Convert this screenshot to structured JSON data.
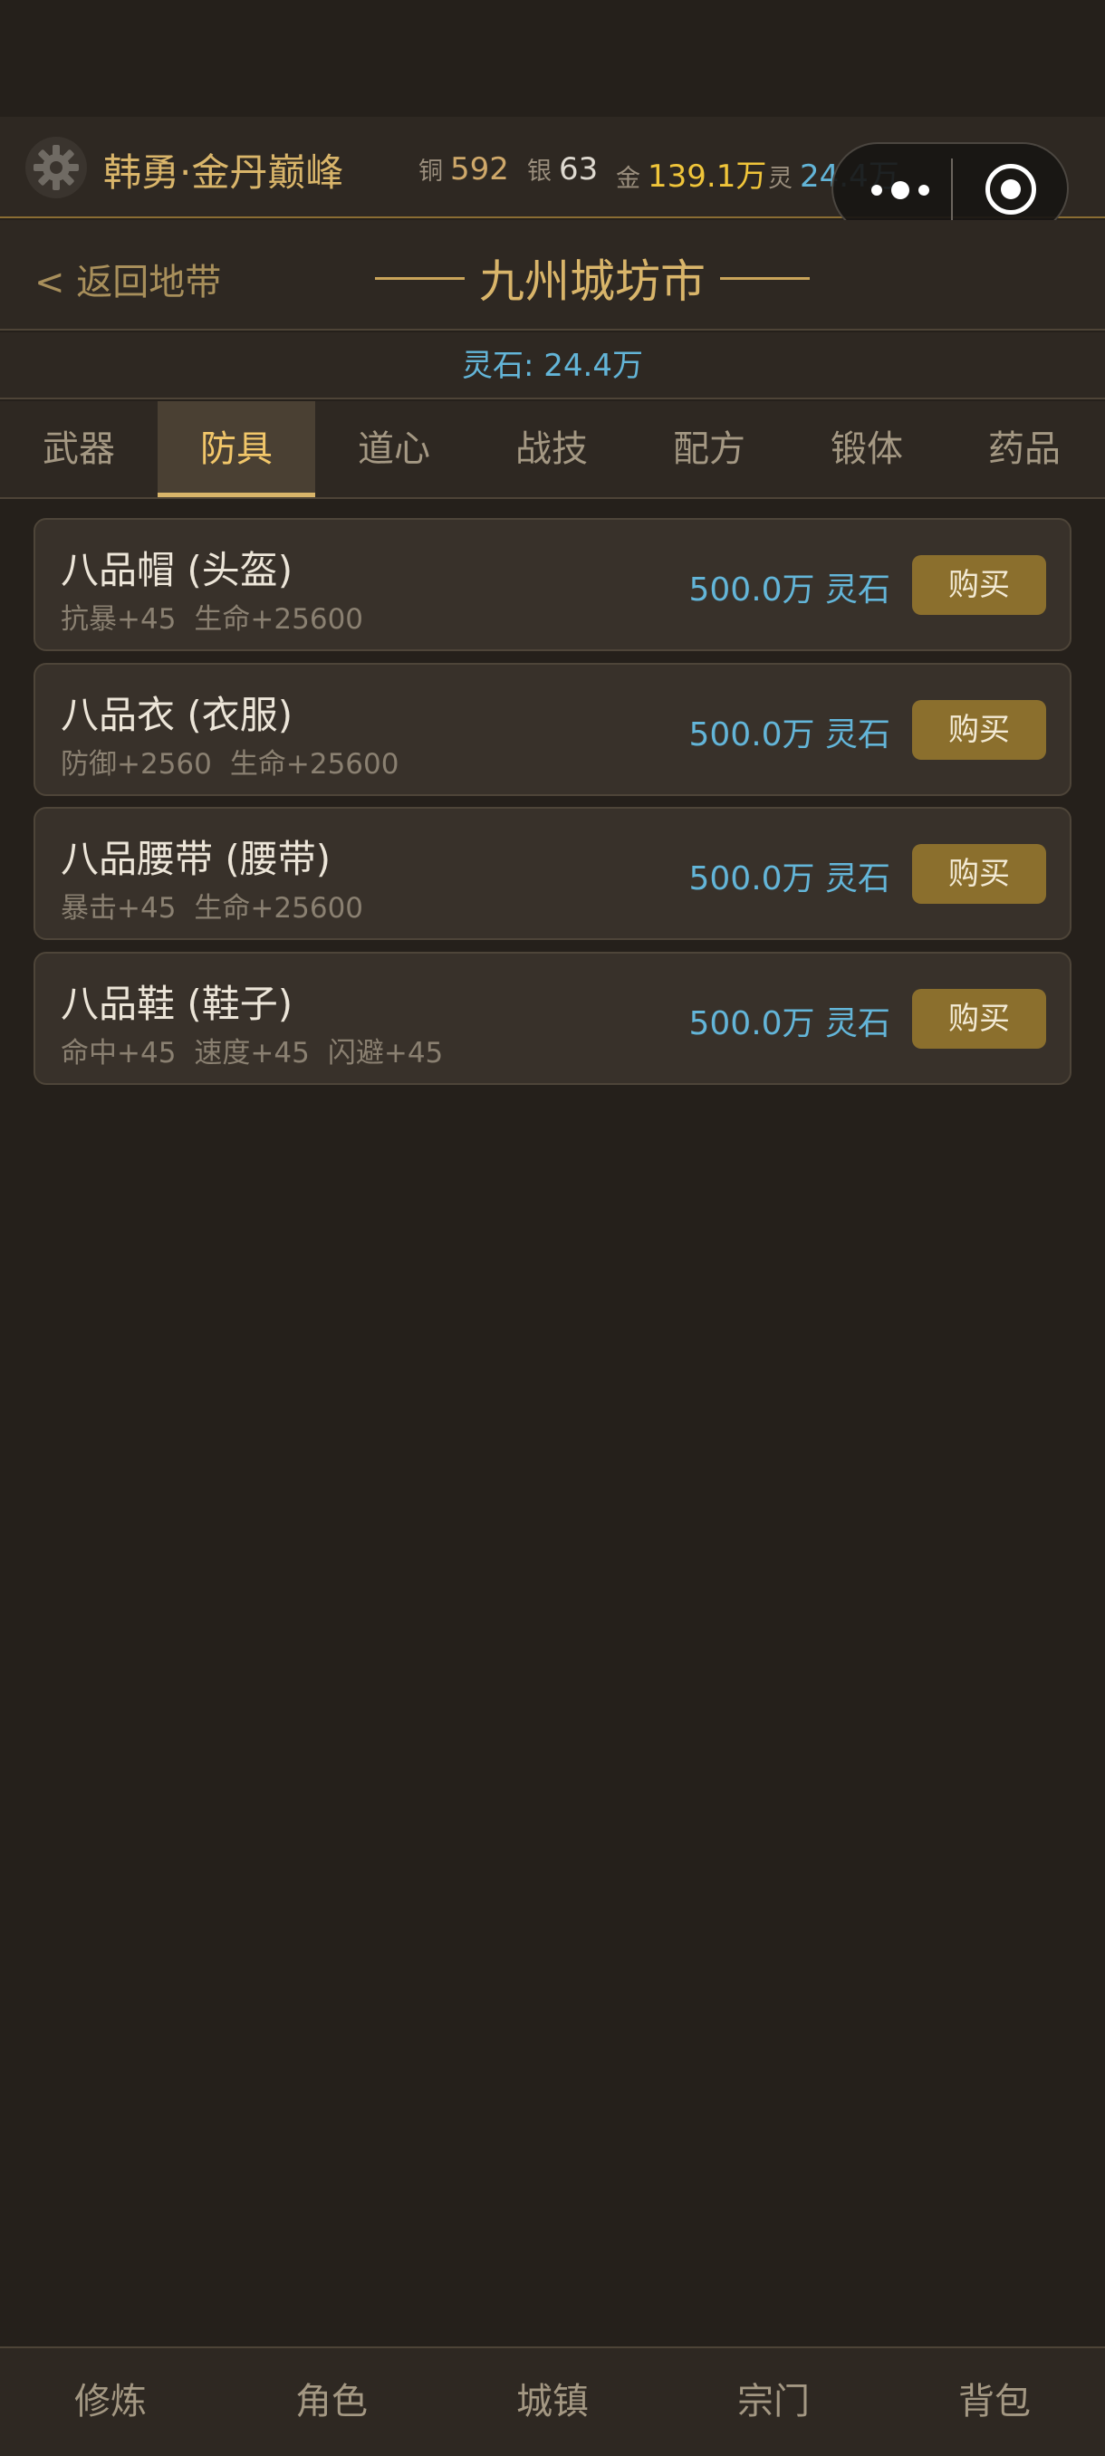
{
  "header": {
    "player_name": "韩勇·金丹巅峰",
    "currencies": [
      {
        "label": "铜",
        "value": "592"
      },
      {
        "label": "银",
        "value": "63"
      },
      {
        "label": "金",
        "value": "139.1万"
      },
      {
        "label": "灵",
        "value": "24.4万"
      }
    ],
    "icons": {
      "settings": "gear-icon",
      "more": "more-dots-icon",
      "close": "target-circle-icon"
    }
  },
  "titlebar": {
    "back_label": "< 返回地带",
    "title": "九州城坊市"
  },
  "balance": {
    "text": "灵石: 24.4万"
  },
  "tabs": [
    {
      "label": "武器",
      "active": false
    },
    {
      "label": "防具",
      "active": true
    },
    {
      "label": "道心",
      "active": false
    },
    {
      "label": "战技",
      "active": false
    },
    {
      "label": "配方",
      "active": false
    },
    {
      "label": "锻体",
      "active": false
    },
    {
      "label": "药品",
      "active": false
    }
  ],
  "items": [
    {
      "name": "八品帽 (头盔)",
      "stats": [
        "抗暴+45",
        "生命+25600"
      ],
      "price": "500.0万 灵石",
      "buy_label": "购买"
    },
    {
      "name": "八品衣 (衣服)",
      "stats": [
        "防御+2560",
        "生命+25600"
      ],
      "price": "500.0万 灵石",
      "buy_label": "购买"
    },
    {
      "name": "八品腰带 (腰带)",
      "stats": [
        "暴击+45",
        "生命+25600"
      ],
      "price": "500.0万 灵石",
      "buy_label": "购买"
    },
    {
      "name": "八品鞋 (鞋子)",
      "stats": [
        "命中+45",
        "速度+45",
        "闪避+45"
      ],
      "price": "500.0万 灵石",
      "buy_label": "购买"
    }
  ],
  "bottom_nav": [
    {
      "label": "修炼"
    },
    {
      "label": "角色"
    },
    {
      "label": "城镇"
    },
    {
      "label": "宗门"
    },
    {
      "label": "背包"
    }
  ],
  "colors": {
    "background": "#25201b",
    "panel": "#2e2822",
    "gold_accent": "#d9b56a",
    "spirit_blue": "#63b5d8",
    "buy_button": "#8b6f2d"
  }
}
